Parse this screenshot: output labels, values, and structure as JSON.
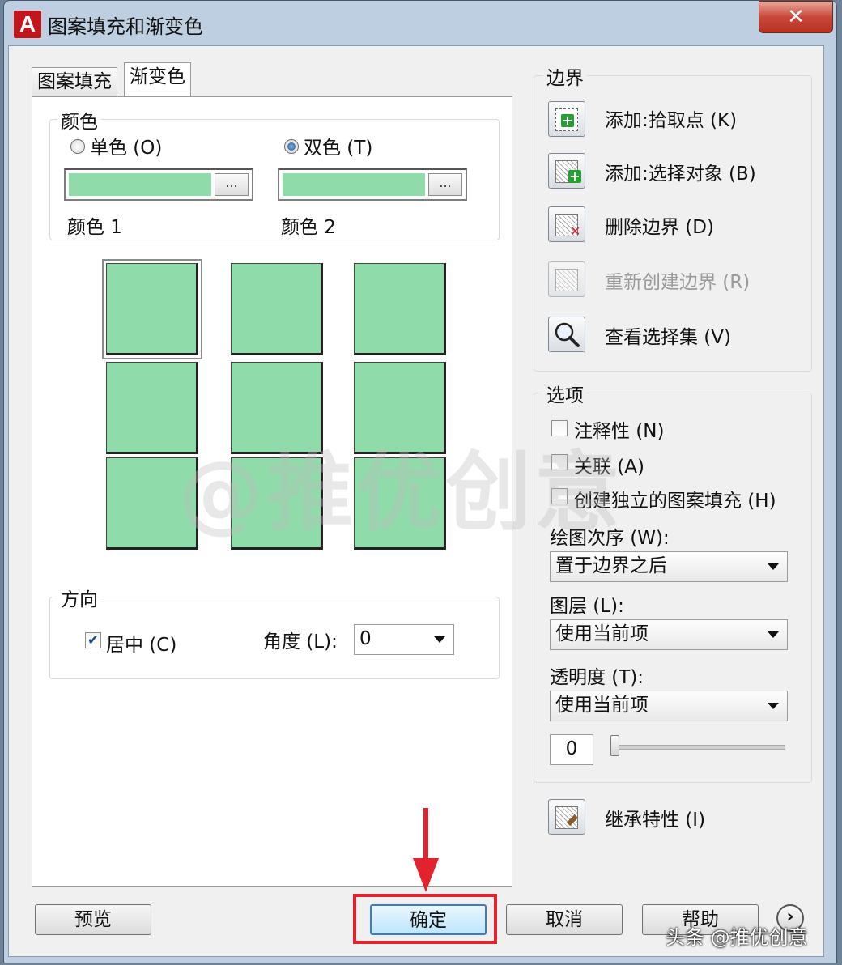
{
  "window": {
    "title": "图案填充和渐变色",
    "close": "✕"
  },
  "tabs": [
    "图案填充",
    "渐变色"
  ],
  "color_group": {
    "title": "颜色",
    "single_label": "单色 (O)",
    "double_label": "双色 (T)",
    "selected": "双色",
    "color1_label": "颜色 1",
    "color2_label": "颜色 2",
    "browse": "...",
    "color1_hex": "#8fdcaa",
    "color2_hex": "#8fdcaa"
  },
  "orientation": {
    "title": "方向",
    "centered_label": "居中 (C)",
    "centered_checked": true,
    "angle_label": "角度 (L):",
    "angle_value": "0"
  },
  "boundary": {
    "title": "边界",
    "add_pick": "添加:拾取点 (K)",
    "add_select": "添加:选择对象 (B)",
    "remove": "删除边界 (D)",
    "recreate": "重新创建边界 (R)",
    "view": "查看选择集 (V)"
  },
  "options": {
    "title": "选项",
    "annotative": "注释性 (N)",
    "associative": "关联 (A)",
    "separate": "创建独立的图案填充 (H)",
    "draw_order_label": "绘图次序 (W):",
    "draw_order_value": "置于边界之后",
    "layer_label": "图层 (L):",
    "layer_value": "使用当前项",
    "transparency_label": "透明度 (T):",
    "transparency_value": "使用当前项",
    "transparency_number": "0"
  },
  "inherit": "继承特性 (I)",
  "buttons": {
    "preview": "预览",
    "ok": "确定",
    "cancel": "取消",
    "help": "帮助"
  },
  "watermark": "@推优创意",
  "footer_brand": "头条 @推优创意",
  "accent": "#e2232e"
}
